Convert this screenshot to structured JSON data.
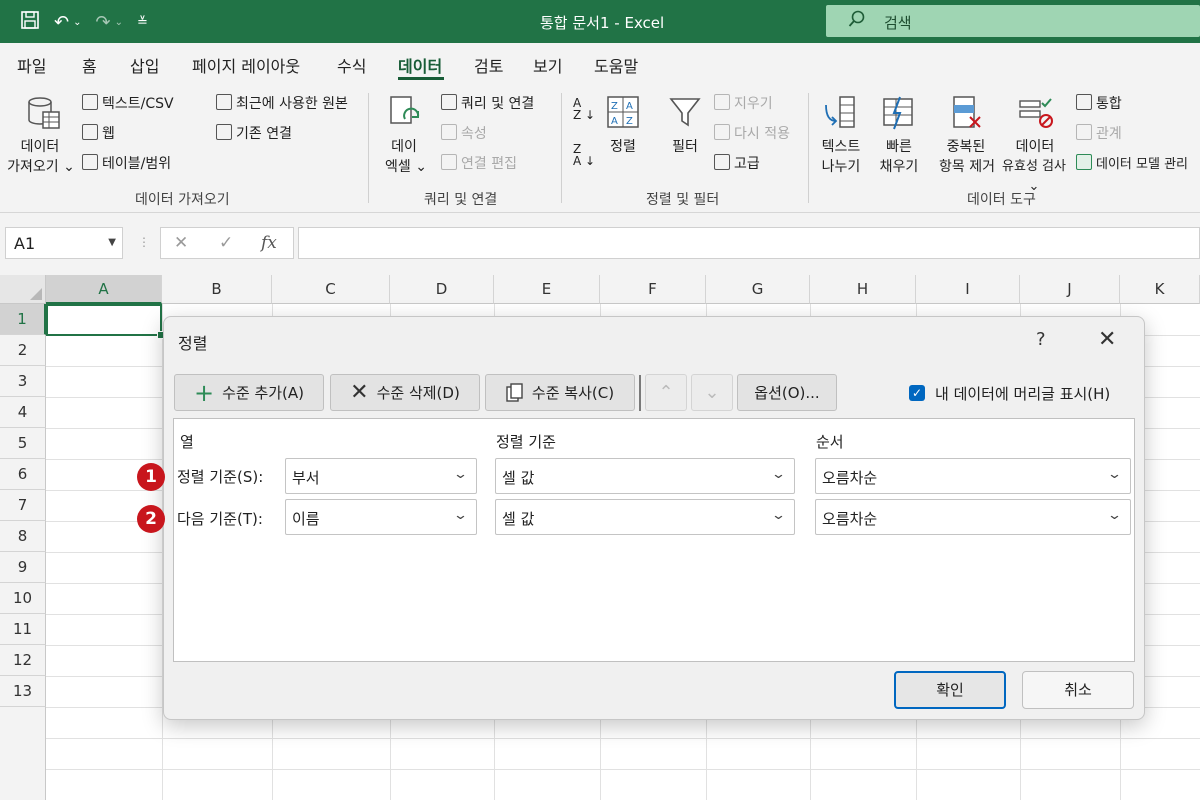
{
  "window": {
    "title": "통합 문서1  -  Excel",
    "search_placeholder": "검색"
  },
  "tabs": [
    "파일",
    "홈",
    "삽입",
    "페이지 레이아웃",
    "수식",
    "데이터",
    "검토",
    "보기",
    "도움말"
  ],
  "active_tab": "데이터",
  "ribbon": {
    "get_data": {
      "label_line1": "데이터",
      "label_line2": "가져오기",
      "text_csv": "텍스트/CSV",
      "web": "웹",
      "table_range": "테이블/범위",
      "recent_sources": "최근에 사용한 원본",
      "existing_connections": "기존 연결",
      "group": "데이터 가져오기"
    },
    "queries": {
      "label_line1": "데이",
      "label_line2": "엑셀",
      "queries_connections": "쿼리 및 연결",
      "properties": "속성",
      "edit_links": "연결 편집",
      "group": "쿼리 및 연결"
    },
    "sort_filter": {
      "sort": "정렬",
      "filter": "필터",
      "clear": "지우기",
      "reapply": "다시 적용",
      "advanced": "고급",
      "group": "정렬 및 필터"
    },
    "data_tools": {
      "text_to_columns_1": "텍스트",
      "text_to_columns_2": "나누기",
      "flash_fill_1": "빠른",
      "flash_fill_2": "채우기",
      "remove_dup_1": "중복된",
      "remove_dup_2": "항목 제거",
      "validation_1": "데이터",
      "validation_2": "유효성 검사",
      "consolidate": "통합",
      "relationships": "관계",
      "data_model": "데이터 모델 관리",
      "group": "데이터 도구"
    }
  },
  "formula_bar": {
    "name_box": "A1",
    "fx": "fx",
    "cancel": "✕",
    "enter": "✓"
  },
  "columns": [
    "A",
    "B",
    "C",
    "D",
    "E",
    "F",
    "G",
    "H",
    "I",
    "J",
    "K"
  ],
  "rows": [
    "1",
    "2",
    "3",
    "4",
    "5",
    "6",
    "7",
    "8",
    "9",
    "10",
    "11",
    "12",
    "13"
  ],
  "dialog": {
    "title": "정렬",
    "help": "?",
    "close": "✕",
    "add_level": "수준 추가(A)",
    "delete_level": "수준 삭제(D)",
    "copy_level": "수준 복사(C)",
    "move_up": "⌃",
    "move_down": "⌄",
    "options": "옵션(O)...",
    "header_checkbox_label": "내 데이터에 머리글 표시(H)",
    "header_checked": true,
    "col_headers": {
      "column": "열",
      "sort_on": "정렬 기준",
      "order": "순서"
    },
    "levels": [
      {
        "badge": "1",
        "label": "정렬 기준(S):",
        "column": "부서",
        "sort_on": "셀 값",
        "order": "오름차순"
      },
      {
        "badge": "2",
        "label": "다음 기준(T):",
        "column": "이름",
        "sort_on": "셀 값",
        "order": "오름차순"
      }
    ],
    "ok": "확인",
    "cancel": "취소"
  }
}
